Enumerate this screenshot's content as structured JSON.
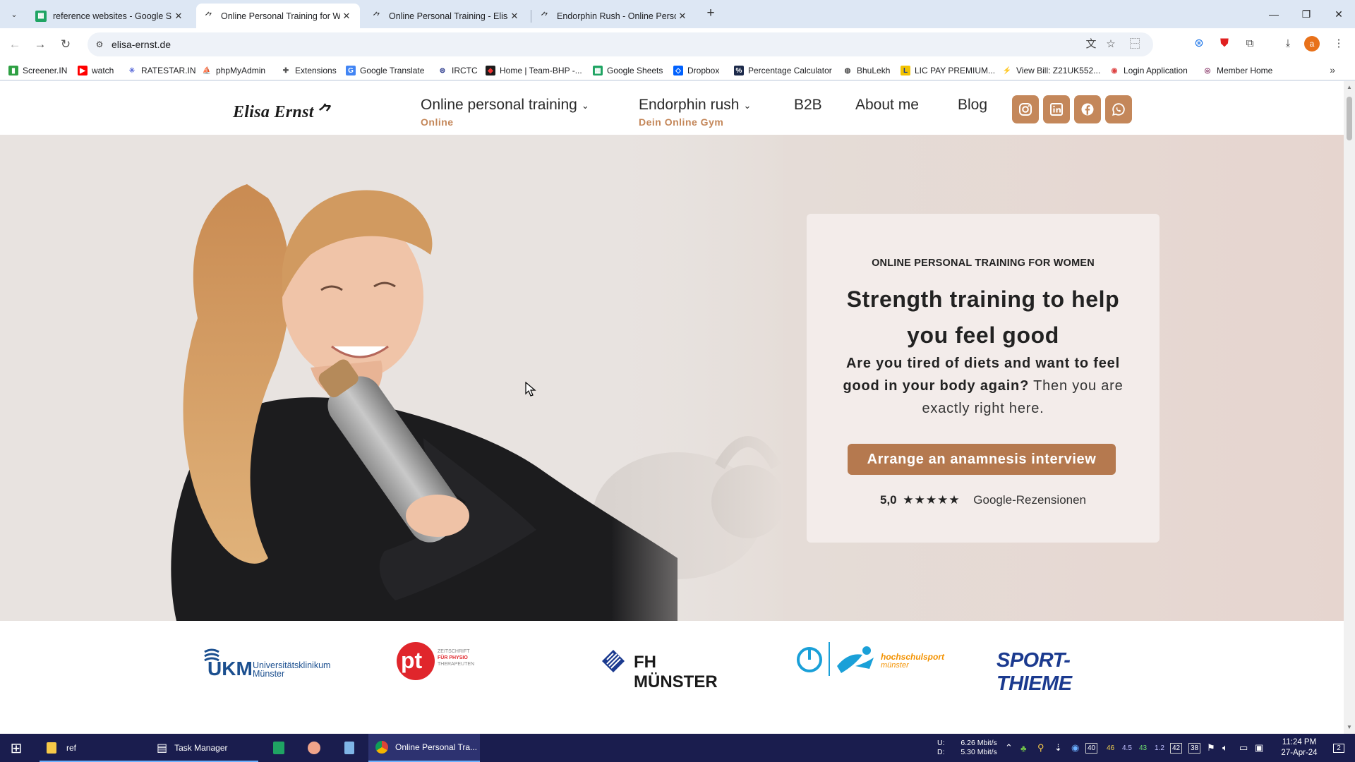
{
  "browser": {
    "tabs": [
      {
        "title": "reference websites - Google Sh",
        "icon": "sheets-icon"
      },
      {
        "title": "Online Personal Training for Wo",
        "icon": "bird-icon",
        "active": true
      },
      {
        "title": "Online Personal Training - Elisa",
        "icon": "bird-icon"
      },
      {
        "title": "Endorphin Rush - Online Perso",
        "icon": "bird-icon"
      }
    ],
    "url": "elisa-ernst.de",
    "bookmarks": [
      "Screener.IN",
      "watch",
      "RATESTAR.IN",
      "phpMyAdmin",
      "Extensions",
      "Google Translate",
      "IRCTC",
      "Home | Team-BHP -...",
      "Google Sheets",
      "Dropbox",
      "Percentage Calculator",
      "BhuLekh",
      "LIC PAY PREMIUM...",
      "View Bill: Z21UK552...",
      "Login Application",
      "Member Home"
    ],
    "profile_initial": "a"
  },
  "site": {
    "logo": "Elisa Ernst",
    "nav": {
      "item1": "Online personal training",
      "item1_sub": "Online",
      "item2": "Endorphin rush",
      "item2_sub": "Dein Online Gym",
      "item3": "B2B",
      "item4": "About me",
      "item5": "Blog"
    },
    "social": [
      "instagram",
      "linkedin",
      "facebook",
      "whatsapp"
    ],
    "hero": {
      "eyebrow": "ONLINE PERSONAL TRAINING FOR WOMEN",
      "headline": "Strength training to help you feel good",
      "sub_bold": "Are you tired of diets and want to feel good in your body again?",
      "sub_rest": " Then you are exactly right here.",
      "cta": "Arrange an anamnesis interview",
      "rating_score": "5,0",
      "rating_stars": "★★★★★",
      "rating_source": "Google-Rezensionen"
    },
    "partners": {
      "ukm_short": "UKM",
      "ukm_line1": "Universitätsklinikum",
      "ukm_line2": "Münster",
      "pt_short": "pt",
      "pt_line1": "ZEITSCHRIFT",
      "pt_line2": "FÜR PHYSIO",
      "pt_line3": "THERAPEUTEN",
      "fh": "FH MÜNSTER",
      "hs_line1": "hochschulsport",
      "hs_line2": "münster",
      "sport_thieme": "SPORT-THIEME"
    }
  },
  "taskbar": {
    "items": [
      "ref",
      "Task Manager",
      "Online Personal Tra..."
    ],
    "net_up_label": "U:",
    "net_up": "6.26 Mbit/s",
    "net_down_label": "D:",
    "net_down": "5.30 Mbit/s",
    "tray_nums": [
      "46",
      "4.5",
      "43",
      "1.2"
    ],
    "tray_boxes": [
      "40",
      "42",
      "38"
    ],
    "time": "11:24 PM",
    "date": "27-Apr-24",
    "notif": "2"
  },
  "colors": {
    "accent": "#c4875a",
    "cta": "#b5794f",
    "card_bg": "#f3ecea"
  }
}
